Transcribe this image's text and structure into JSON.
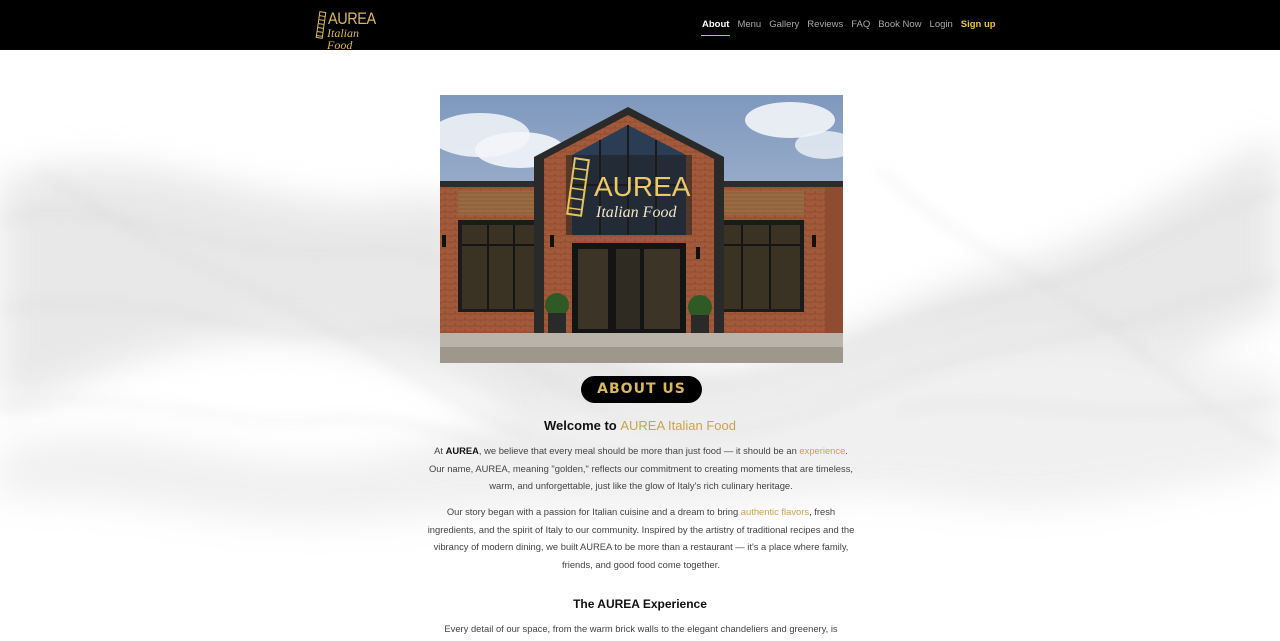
{
  "nav": {
    "logo_brand": "AUREA",
    "logo_sub": "Italian Food",
    "links": [
      {
        "label": "About"
      },
      {
        "label": "Menu"
      },
      {
        "label": "Gallery"
      },
      {
        "label": "Reviews"
      },
      {
        "label": "FAQ"
      },
      {
        "label": "Book Now"
      },
      {
        "label": "Login"
      },
      {
        "label": "Sign up"
      }
    ]
  },
  "hero": {
    "sign_brand": "AUREA",
    "sign_sub": "Italian Food"
  },
  "about": {
    "pill_label": "ABOUT US",
    "welcome_prefix": "Welcome to",
    "welcome_name": "AUREA Italian Food",
    "p1": {
      "a": "At",
      "b": "AUREA",
      "c": ", we believe that every meal should be more than just food — it should be an",
      "d": "experience",
      "e": ". Our name, AUREA, meaning \"golden,\" reflects our commitment to creating moments that are timeless, warm, and unforgettable, just like the glow of Italy's rich culinary heritage."
    },
    "p2": {
      "a": "Our story began with a passion for Italian cuisine and a dream to bring",
      "b": "authentic flavors",
      "c": ", fresh ingredients, and the spirit of Italy to our community. Inspired by the artistry of traditional recipes and the vibrancy of modern dining, we built AUREA to be more than a restaurant — it's a place where family, friends, and good food come together."
    },
    "experience_title": "The AUREA Experience",
    "p3": "Every detail of our space, from the warm brick walls to the elegant chandeliers and greenery, is designed"
  },
  "colors": {
    "gold": "#caa34a",
    "nav_bg": "#000000",
    "signup": "#f0c040"
  }
}
